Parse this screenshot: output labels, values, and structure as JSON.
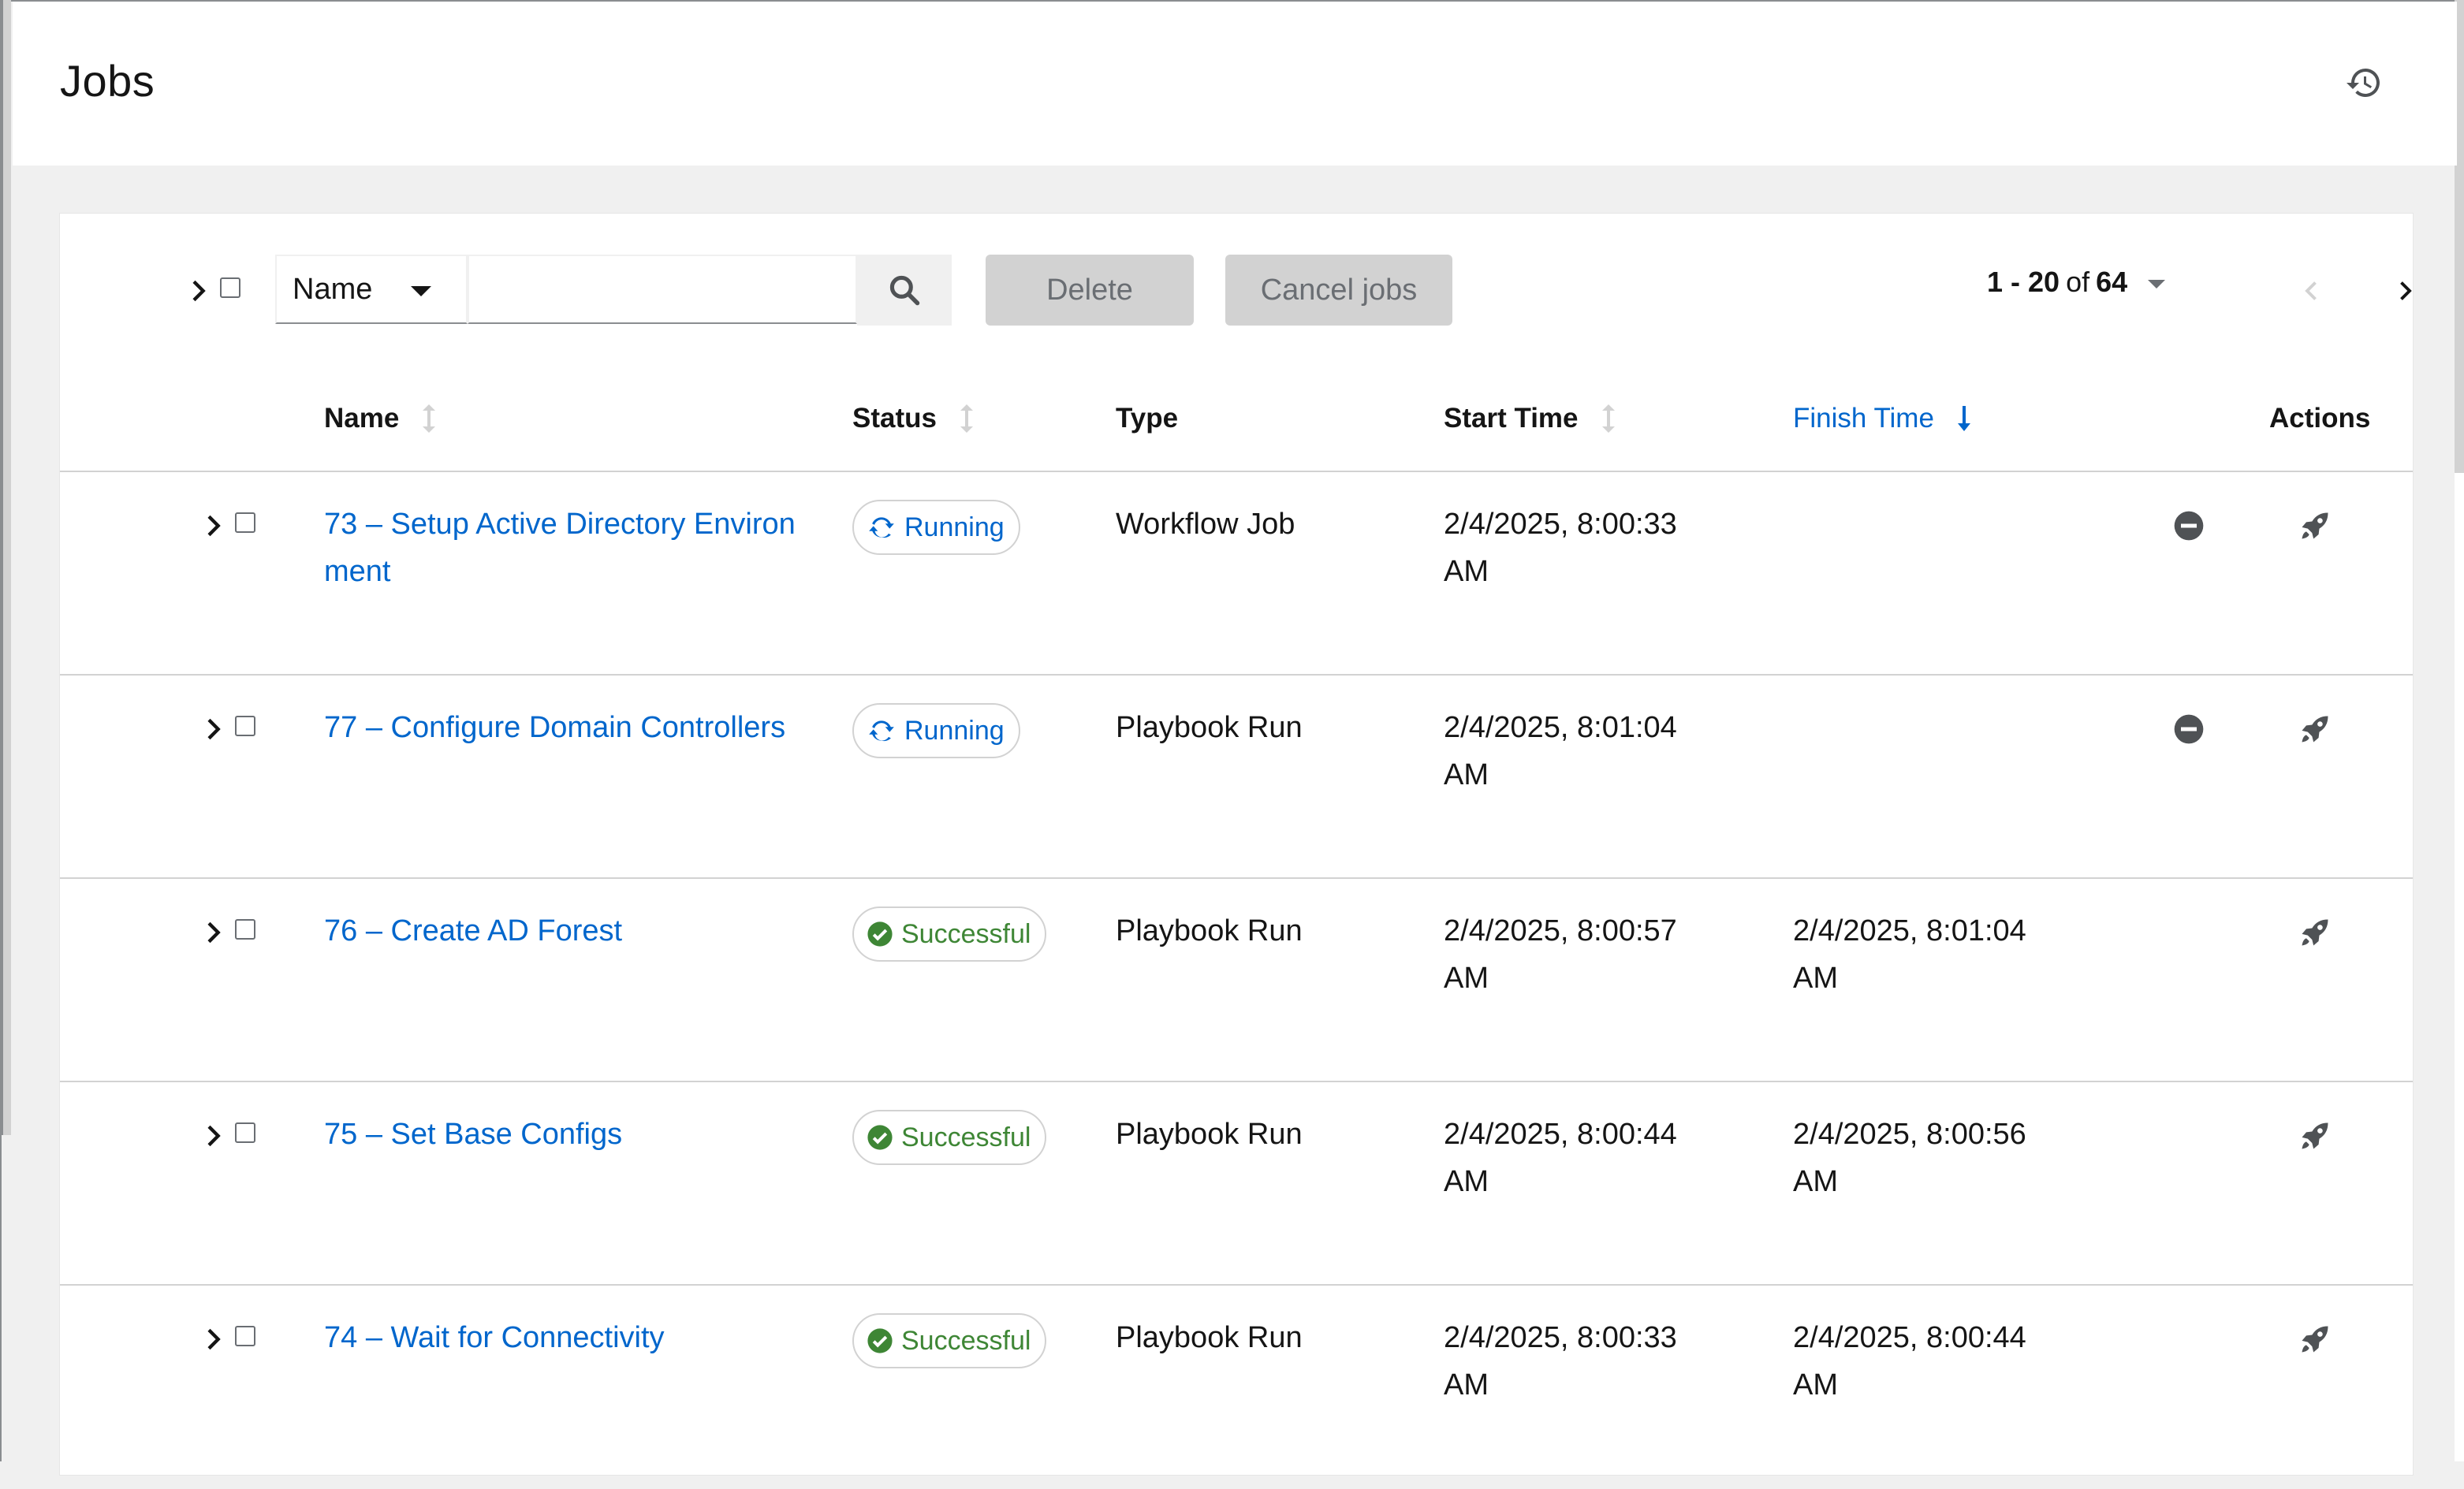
{
  "header": {
    "title": "Jobs",
    "history_icon": "history-icon"
  },
  "toolbar": {
    "search_filter": "Name",
    "search_placeholder": "",
    "delete_label": "Delete",
    "cancel_label": "Cancel jobs",
    "pagination": {
      "range": "1 - 20",
      "of_label": "of",
      "total": "64"
    }
  },
  "columns": {
    "name": "Name",
    "status": "Status",
    "type": "Type",
    "start_time": "Start Time",
    "finish_time": "Finish Time",
    "actions": "Actions"
  },
  "colors": {
    "link": "#0066cc",
    "success": "#3e8635",
    "running": "#0066cc"
  },
  "jobs": [
    {
      "name": "73 – Setup Active Directory Environment",
      "status": "Running",
      "type": "Workflow Job",
      "start_date": "2/4/2025, 8:00:33",
      "start_ampm": "AM",
      "finish_date": "",
      "finish_ampm": "",
      "cancelable": true
    },
    {
      "name": "77 – Configure Domain Controllers",
      "status": "Running",
      "type": "Playbook Run",
      "start_date": "2/4/2025, 8:01:04",
      "start_ampm": "AM",
      "finish_date": "",
      "finish_ampm": "",
      "cancelable": true
    },
    {
      "name": "76 – Create AD Forest",
      "status": "Successful",
      "type": "Playbook Run",
      "start_date": "2/4/2025, 8:00:57",
      "start_ampm": "AM",
      "finish_date": "2/4/2025, 8:01:04",
      "finish_ampm": "AM",
      "cancelable": false
    },
    {
      "name": "75 – Set Base Configs",
      "status": "Successful",
      "type": "Playbook Run",
      "start_date": "2/4/2025, 8:00:44",
      "start_ampm": "AM",
      "finish_date": "2/4/2025, 8:00:56",
      "finish_ampm": "AM",
      "cancelable": false
    },
    {
      "name": "74 – Wait for Connectivity",
      "status": "Successful",
      "type": "Playbook Run",
      "start_date": "2/4/2025, 8:00:33",
      "start_ampm": "AM",
      "finish_date": "2/4/2025, 8:00:44",
      "finish_ampm": "AM",
      "cancelable": false
    }
  ]
}
